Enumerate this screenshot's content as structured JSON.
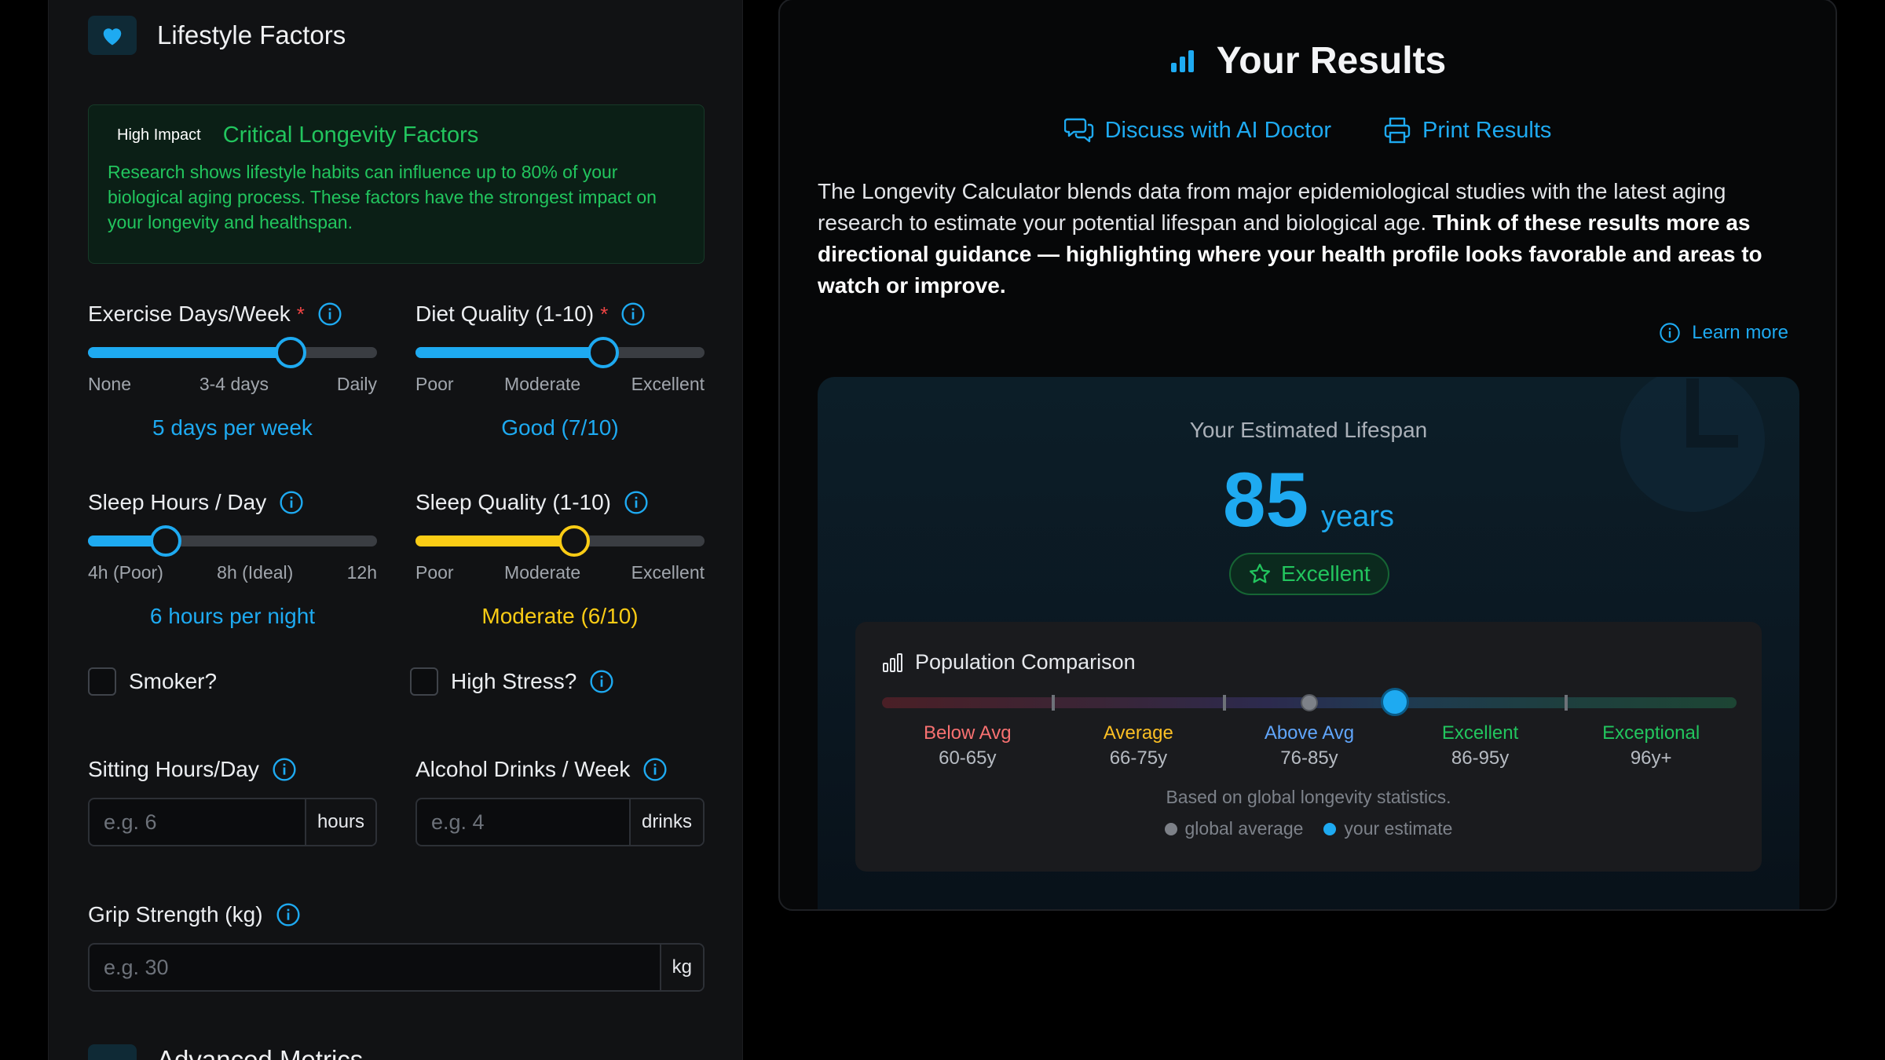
{
  "left": {
    "section_title": "Lifestyle Factors",
    "impact": {
      "badge": "High Impact",
      "title": "Critical Longevity Factors",
      "text": "Research shows lifestyle habits can influence up to 80% of your biological aging process. These factors have the strongest impact on your longevity and healthspan."
    },
    "exercise": {
      "label": "Exercise Days/Week",
      "required": "*",
      "ticks": [
        "None",
        "3-4 days",
        "Daily"
      ],
      "value_text": "5 days per week",
      "level": 0.7,
      "color": "#1eaaf1"
    },
    "diet": {
      "label": "Diet Quality (1-10)",
      "required": "*",
      "ticks": [
        "Poor",
        "Moderate",
        "Excellent"
      ],
      "value_text": "Good (7/10)",
      "level": 0.65,
      "color": "#1eaaf1"
    },
    "sleep_hours": {
      "label": "Sleep Hours / Day",
      "ticks": [
        "4h (Poor)",
        "8h (Ideal)",
        "12h"
      ],
      "value_text": "6 hours per night",
      "level": 0.27,
      "color": "#1eaaf1"
    },
    "sleep_quality": {
      "label": "Sleep Quality (1-10)",
      "ticks": [
        "Poor",
        "Moderate",
        "Excellent"
      ],
      "value_text": "Moderate (6/10)",
      "level": 0.55,
      "color": "#facc15"
    },
    "smoker_label": "Smoker?",
    "stress_label": "High Stress?",
    "sitting": {
      "label": "Sitting Hours/Day",
      "placeholder": "e.g. 6",
      "unit": "hours"
    },
    "alcohol": {
      "label": "Alcohol Drinks / Week",
      "placeholder": "e.g. 4",
      "unit": "drinks"
    },
    "grip": {
      "label": "Grip Strength (kg)",
      "placeholder": "e.g. 30",
      "unit": "kg"
    },
    "next_section_title": "Advanced Metrics"
  },
  "results": {
    "title": "Your Results",
    "discuss": "Discuss with AI Doctor",
    "print": "Print Results",
    "desc_plain": "The Longevity Calculator blends data from major epidemiological studies with the latest aging research to estimate your potential lifespan and biological age. ",
    "desc_bold": "Think of these results more as directional guidance — highlighting where your health profile looks favorable and areas to watch or improve.",
    "learn_more": "Learn more",
    "estimate_label": "Your Estimated Lifespan",
    "estimate_value": "85",
    "estimate_unit": "years",
    "rating": "Excellent",
    "population": {
      "title": "Population Comparison",
      "categories": [
        {
          "name": "Below Avg",
          "range": "60-65y",
          "color": "#f87171"
        },
        {
          "name": "Average",
          "range": "66-75y",
          "color": "#fbbf24"
        },
        {
          "name": "Above Avg",
          "range": "76-85y",
          "color": "#60a5fa"
        },
        {
          "name": "Excellent",
          "range": "86-95y",
          "color": "#22c55e"
        },
        {
          "name": "Exceptional",
          "range": "96y+",
          "color": "#22c55e"
        }
      ],
      "global_marker": 0.5,
      "estimate_marker": 0.6,
      "note": "Based on global longevity statistics.",
      "legend_global": "global average",
      "legend_estimate": "your estimate"
    },
    "accent": "#1eaaf1"
  }
}
